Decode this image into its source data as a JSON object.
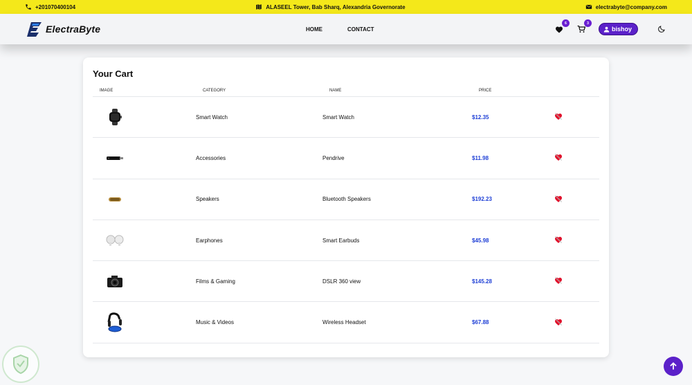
{
  "topbar": {
    "phone": "+201070400104",
    "address": "ALASEEL Tower, Bab Sharq, Alexandria Governorate",
    "email": "electrabyte@company.com"
  },
  "navbar": {
    "brand": "ElectraByte",
    "links": [
      "HOME",
      "CONTACT"
    ],
    "wishlist_count": "6",
    "cart_count": "3",
    "username": "bishoy"
  },
  "cart": {
    "title": "Your Cart",
    "headers": [
      "IMAGE",
      "CATEGORY",
      "NAME",
      "PRICE"
    ],
    "rows": [
      {
        "category": "Smart Watch",
        "name": "Smart Watch",
        "price": "$12.35",
        "thumb": "smart-watch"
      },
      {
        "category": "Accessories",
        "name": "Pendrive",
        "price": "$11.98",
        "thumb": "pendrive"
      },
      {
        "category": "Speakers",
        "name": "Bluetooth Speakers",
        "price": "$192.23",
        "thumb": "speaker"
      },
      {
        "category": "Earphones",
        "name": "Smart Earbuds",
        "price": "$45.98",
        "thumb": "earbuds"
      },
      {
        "category": "Films & Gaming",
        "name": "DSLR 360 view",
        "price": "$145.28",
        "thumb": "camera"
      },
      {
        "category": "Music & Videos",
        "name": "Wireless Headset",
        "price": "$67.88",
        "thumb": "headset"
      }
    ]
  },
  "colors": {
    "topbar": "#f4e81a",
    "accent": "#5b21c9",
    "price": "#1e3fd6",
    "remove": "#e0112b"
  }
}
